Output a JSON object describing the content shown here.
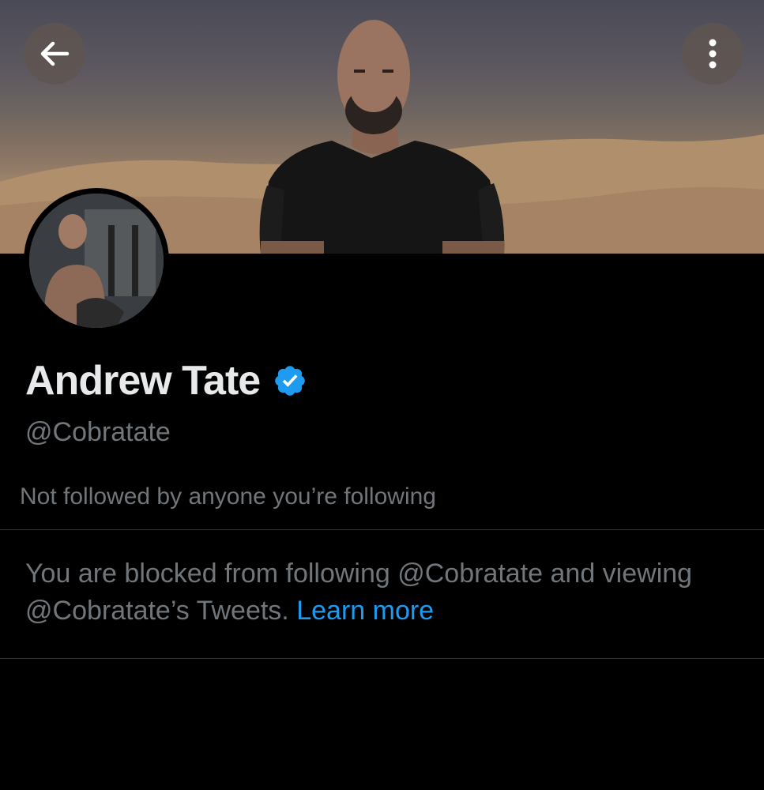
{
  "header": {
    "back_icon": "arrow-left-icon",
    "more_icon": "more-vertical-icon",
    "button_bg": "#5f5550"
  },
  "profile": {
    "display_name": "Andrew Tate",
    "verified": true,
    "verified_color": "#1d9bf0",
    "handle": "@Cobratate",
    "followers_note": "Not followed by anyone you’re following"
  },
  "blocked_notice": {
    "message": "You are blocked from following @Cobratate and viewing @Cobratate’s Tweets. ",
    "link_label": "Learn more",
    "link_color": "#1d9bf0"
  },
  "theme": {
    "background": "#000000",
    "primary_text": "#e7e9ea",
    "secondary_text": "#71767b",
    "divider": "#2f3336"
  }
}
